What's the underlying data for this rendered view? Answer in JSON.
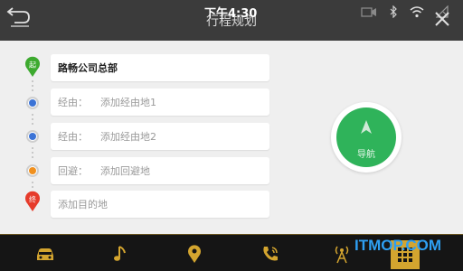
{
  "status_bar": {
    "time": "下午4:30",
    "icons": [
      "camera-icon",
      "bluetooth-icon",
      "wifi-icon",
      "signal-off-icon"
    ]
  },
  "header": {
    "title": "行程规划",
    "back_icon": "back-arrow-icon",
    "close_icon": "close-icon"
  },
  "route": {
    "start": {
      "badge": "起",
      "label": "路畅公司总部"
    },
    "waypoints": [
      {
        "prefix": "经由：",
        "placeholder": "添加经由地1"
      },
      {
        "prefix": "经由：",
        "placeholder": "添加经由地2"
      }
    ],
    "avoid": {
      "prefix": "回避：",
      "placeholder": "添加回避地"
    },
    "end": {
      "badge": "终",
      "placeholder": "添加目的地"
    }
  },
  "navigate_button": {
    "label": "导航",
    "icon": "navigation-arrow-icon"
  },
  "dock": {
    "items": [
      "car-icon",
      "music-note-icon",
      "location-pin-icon",
      "phone-icon",
      "radio-tower-icon",
      "apps-grid-icon"
    ]
  },
  "watermark": "ITMOP.COM",
  "colors": {
    "start_pin": "#3daa2f",
    "waypoint": "#3b73d6",
    "avoid": "#f0901e",
    "end_pin": "#e63b2b",
    "navigate": "#2fb35a",
    "dock_accent": "#d4a52f"
  }
}
